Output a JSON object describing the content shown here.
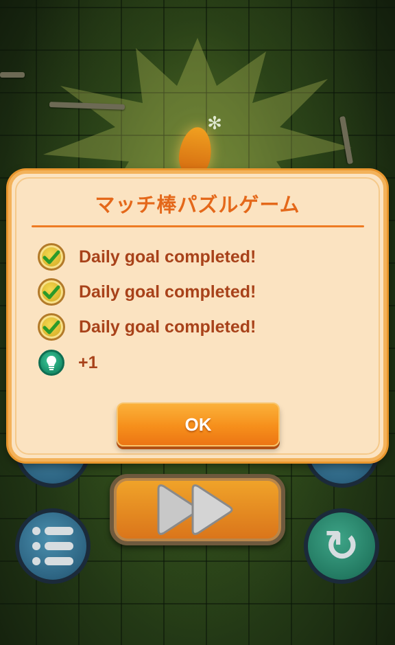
{
  "dialog": {
    "title": "マッチ棒パズルゲーム",
    "rewards": [
      {
        "icon": "checkmark-badge-icon",
        "label": "Daily goal completed!"
      },
      {
        "icon": "checkmark-badge-icon",
        "label": "Daily goal completed!"
      },
      {
        "icon": "checkmark-badge-icon",
        "label": "Daily goal completed!"
      },
      {
        "icon": "lightbulb-hint-icon",
        "label": "+1"
      }
    ],
    "ok_label": "OK"
  },
  "background": {
    "icons": [
      "menu-list-icon",
      "fast-forward-icon",
      "restart-icon"
    ]
  },
  "colors": {
    "dialog_bg": "#fbe3c1",
    "dialog_border": "#f3b25a",
    "title": "#e4681a",
    "text": "#a8421a",
    "ok_button": "#f68f1b"
  }
}
